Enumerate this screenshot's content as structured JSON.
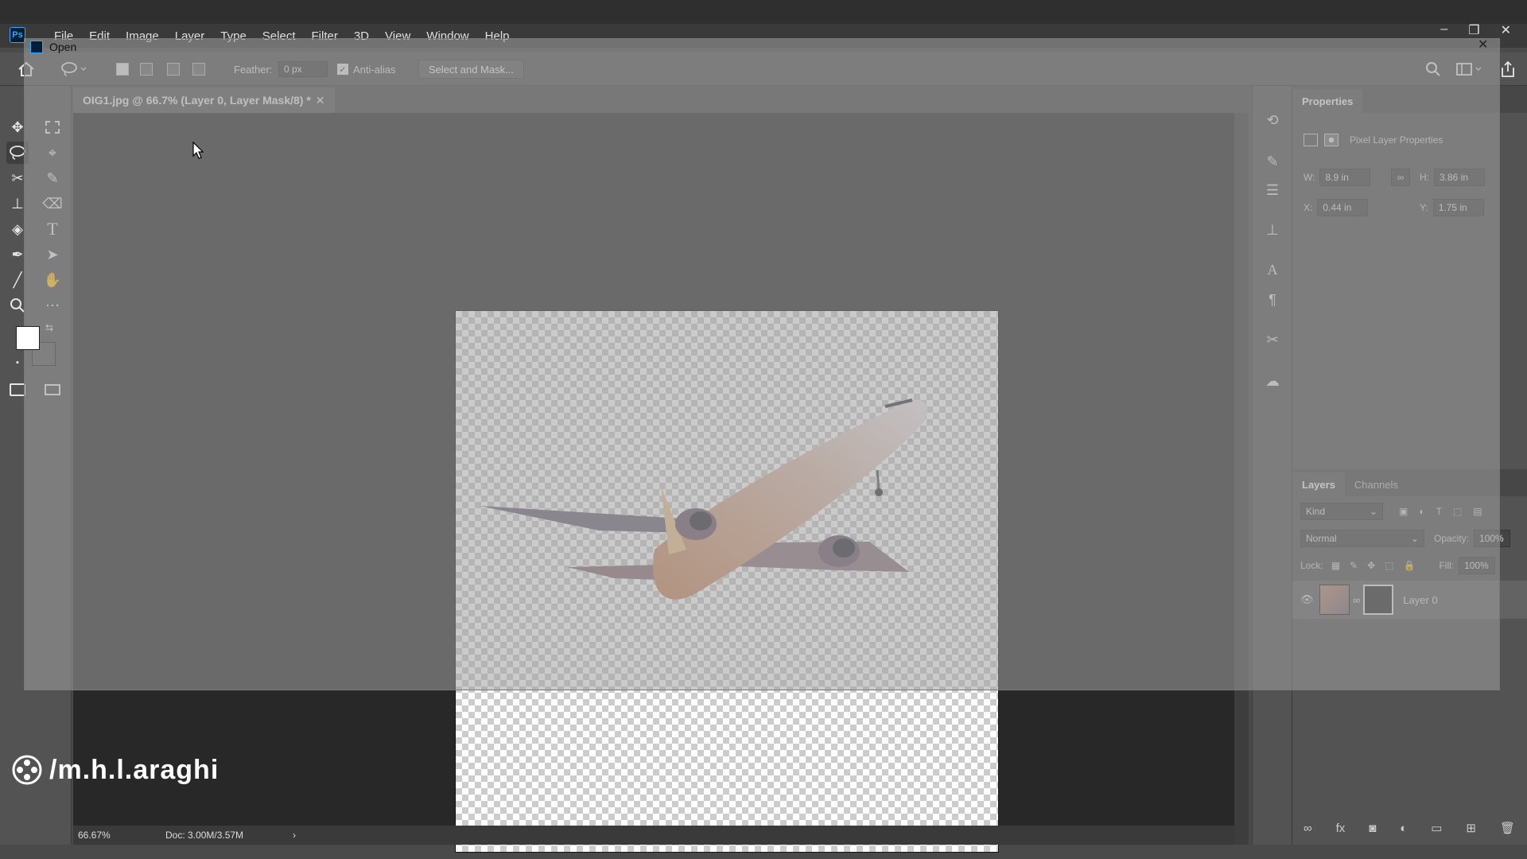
{
  "app": {
    "logo": "Ps"
  },
  "menu": [
    "File",
    "Edit",
    "Image",
    "Layer",
    "Type",
    "Select",
    "Filter",
    "3D",
    "View",
    "Window",
    "Help"
  ],
  "window_controls": [
    "–",
    "❐",
    "✕"
  ],
  "options_bar": {
    "feather_label": "Feather:",
    "feather_value": "0 px",
    "antialias_label": "Anti-alias",
    "select_mask_label": "Select and Mask..."
  },
  "document_tab": {
    "title": "OIG1.jpg @ 66.7% (Layer 0, Layer Mask/8) *",
    "close": "✕"
  },
  "status": {
    "zoom": "66.67%",
    "doc": "Doc: 3.00M/3.57M",
    "arrow": "›"
  },
  "properties": {
    "tab": "Properties",
    "subtitle": "Pixel Layer Properties",
    "w_label": "W:",
    "w_value": "8.9 in",
    "h_label": "H:",
    "h_value": "3.86 in",
    "x_label": "X:",
    "x_value": "0.44 in",
    "y_label": "Y:",
    "y_value": "1.75 in"
  },
  "layers_panel": {
    "tabs": [
      "Layers",
      "Channels"
    ],
    "kind_label": "Kind",
    "blend_mode": "Normal",
    "opacity_label": "Opacity:",
    "opacity_value": "100%",
    "lock_label": "Lock:",
    "fill_label": "Fill:",
    "fill_value": "100%",
    "layer_name": "Layer 0"
  },
  "dialog": {
    "title": "Open",
    "close": "✕"
  },
  "watermark": {
    "text": "/m.h.l.araghi"
  },
  "colors": {
    "accent": "#31a8ff",
    "canvas_bg": "#282828",
    "panel_bg": "#535353"
  }
}
